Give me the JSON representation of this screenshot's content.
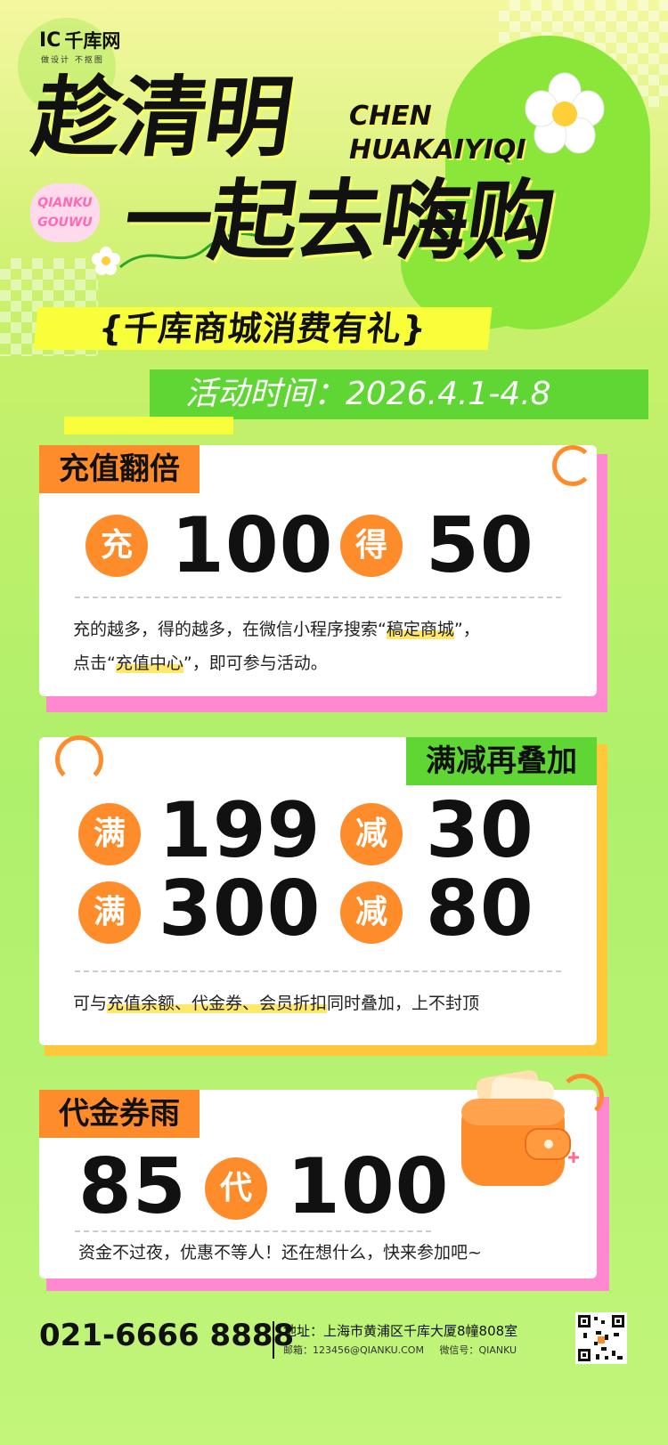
{
  "logo": {
    "mark": "IC",
    "name": "千库网",
    "slogan": "做设计 不抠图"
  },
  "headline": {
    "line1": "趁清明",
    "line2": "一起去嗨购",
    "en_line1": "CHEN",
    "en_line2": "HUAKAIYIQI",
    "tag_line1": "QIANKU",
    "tag_line2": "GOUWU"
  },
  "subtitle": "{千库商城消费有礼}",
  "date": {
    "label": "活动时间：",
    "value": "2026.4.1-4.8"
  },
  "card1": {
    "tag": "充值翻倍",
    "badge1": "充",
    "amount1": "100",
    "badge2": "得",
    "amount2": "50",
    "desc_a": "充的越多，得的越多，在微信小程序搜索“",
    "desc_hl1": "稿定商城",
    "desc_b": "”，",
    "desc_c": "点击“",
    "desc_hl2": "充值中心",
    "desc_d": "”，即可参与活动。"
  },
  "card2": {
    "tag": "满减再叠加",
    "row1": {
      "badge1": "满",
      "amount1": "199",
      "badge2": "减",
      "amount2": "30"
    },
    "row2": {
      "badge1": "满",
      "amount1": "300",
      "badge2": "减",
      "amount2": "80"
    },
    "desc_a": "可与",
    "desc_hl": "充值余额、代金券、会员折扣",
    "desc_b": "同时叠加，上不封顶"
  },
  "card3": {
    "tag": "代金券雨",
    "amount1": "85",
    "badge": "代",
    "amount2": "100",
    "desc": "资金不过夜，优惠不等人！还在想什么，快来参加吧~"
  },
  "footer": {
    "phone": "021-6666 8888",
    "address": "地址：上海市黄浦区千库大厦8幢808室",
    "email_label": "邮箱：",
    "email": "123456@QIANKU.COM",
    "wechat_label": "微信号：",
    "wechat": "QIANKU"
  },
  "colors": {
    "accent_orange": "#ff8c2a",
    "accent_green": "#5fd634",
    "accent_yellow": "#f8ff3a",
    "accent_pink": "#ff88d0"
  },
  "icons": [
    "flower-icon",
    "wallet-icon",
    "qr-code-icon"
  ]
}
